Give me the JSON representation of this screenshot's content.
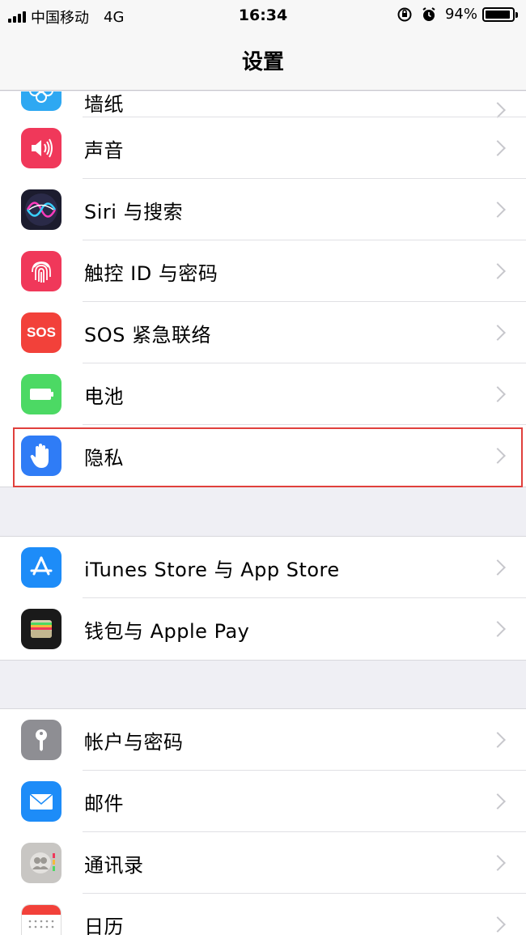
{
  "status_bar": {
    "carrier": "中国移动",
    "network": "4G",
    "time": "16:34",
    "battery_percent": "94%",
    "battery_level": 0.94,
    "icons": [
      "signal-icon",
      "rotation-lock-icon",
      "alarm-icon",
      "battery-icon"
    ]
  },
  "nav": {
    "title": "设置"
  },
  "top_partial": {
    "label": "墙纸",
    "icon": "wallpaper-icon"
  },
  "group1": [
    {
      "label": "声音",
      "icon": "speaker-icon",
      "color": "#f0385a"
    },
    {
      "label": "Siri 与搜索",
      "icon": "siri-icon",
      "color": "#1c1c2e"
    },
    {
      "label": "触控 ID 与密码",
      "icon": "fingerprint-icon",
      "color": "#f0385a"
    },
    {
      "label": "SOS 紧急联络",
      "icon": "sos-icon",
      "icon_text": "SOS",
      "color": "#f2413a"
    },
    {
      "label": "电池",
      "icon": "battery-app-icon",
      "color": "#4cd964"
    },
    {
      "label": "隐私",
      "icon": "hand-icon",
      "color": "#2f7cf6",
      "highlighted": true
    }
  ],
  "group2": [
    {
      "label": "iTunes Store 与 App Store",
      "icon": "app-store-icon",
      "color": "#1d8cf8"
    },
    {
      "label": "钱包与 Apple Pay",
      "icon": "wallet-icon",
      "color": "#1a1a1a"
    }
  ],
  "group3": [
    {
      "label": "帐户与密码",
      "icon": "key-icon",
      "color": "#8e8e93"
    },
    {
      "label": "邮件",
      "icon": "mail-icon",
      "color": "#1d8cf8"
    },
    {
      "label": "通讯录",
      "icon": "contacts-icon",
      "color": "#c8c6c3"
    },
    {
      "label": "日历",
      "icon": "calendar-icon",
      "color": "#ffffff"
    }
  ]
}
